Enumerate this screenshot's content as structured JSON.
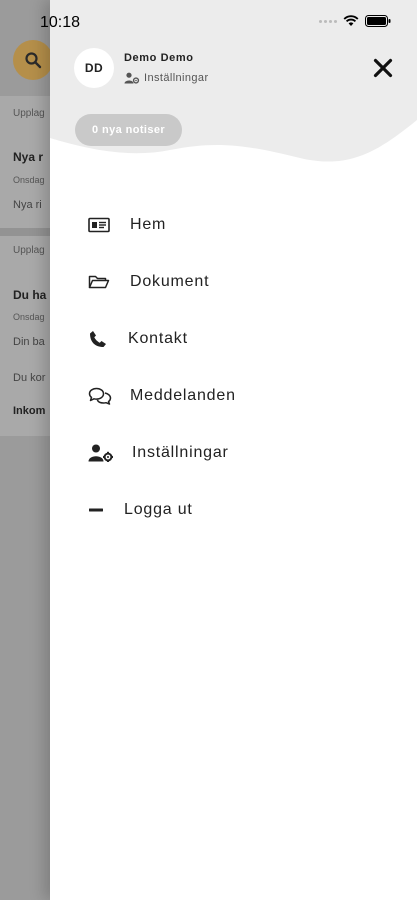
{
  "status_bar": {
    "time": "10:18"
  },
  "background_app": {
    "sections": [
      {
        "label": "Upplag",
        "title": "Nya r",
        "date": "Onsdag",
        "body": "Nya ri"
      },
      {
        "label": "Upplag",
        "title": "Du ha",
        "date": "Onsdag",
        "body": "Din ba",
        "body2": "Du kor",
        "footer": "Inkom"
      }
    ]
  },
  "drawer": {
    "avatar_initials": "DD",
    "user_name": "Demo Demo",
    "settings_link": "Inställningar",
    "notifications_badge": "0 nya notiser",
    "menu": [
      {
        "label": "Hem",
        "icon": "home-card-icon"
      },
      {
        "label": "Dokument",
        "icon": "folder-icon"
      },
      {
        "label": "Kontakt",
        "icon": "phone-icon"
      },
      {
        "label": "Meddelanden",
        "icon": "chat-icon"
      },
      {
        "label": "Inställningar",
        "icon": "user-settings-icon"
      },
      {
        "label": "Logga ut",
        "icon": "minus-icon"
      }
    ]
  },
  "colors": {
    "accent": "#b58f4a",
    "header_bg": "#ececec",
    "pill_bg": "#c9c9c9"
  }
}
